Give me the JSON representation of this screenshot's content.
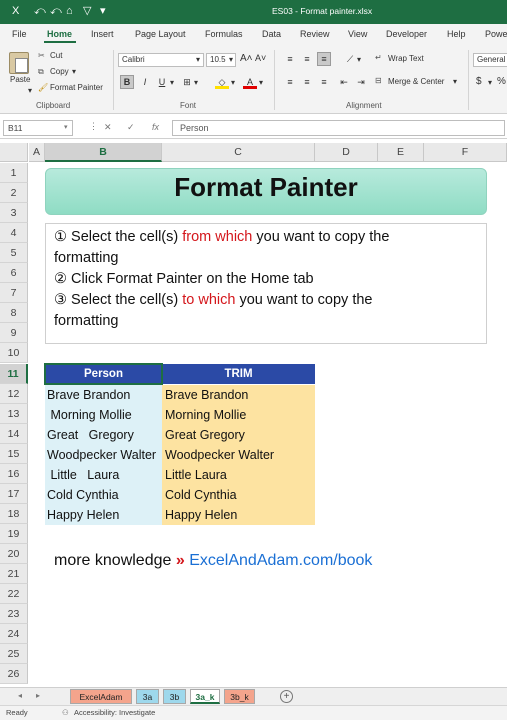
{
  "window": {
    "title": "ES03 - Format painter.xlsx",
    "quick_access": [
      "X",
      "⤺",
      "⤺",
      "⌂",
      "▽",
      "▾"
    ]
  },
  "ribbon_tabs": [
    "File",
    "Home",
    "Insert",
    "Page Layout",
    "Formulas",
    "Data",
    "Review",
    "View",
    "Developer",
    "Help",
    "Power"
  ],
  "active_tab": "Home",
  "clipboard": {
    "paste": "Paste",
    "cut": "Cut",
    "copy": "Copy",
    "format_painter": "Format Painter",
    "group_label": "Clipboard"
  },
  "font": {
    "name": "Calibri",
    "size": "10.5",
    "bold": "B",
    "italic": "I",
    "underline": "U",
    "font_color_glyph": "A",
    "group_label": "Font"
  },
  "alignment": {
    "wrap_text": "Wrap Text",
    "merge_center": "Merge & Center",
    "group_label": "Alignment"
  },
  "number": {
    "format": "General",
    "currency": "$"
  },
  "formula_bar": {
    "name_box": "B11",
    "cancel": "✕",
    "enter": "✓",
    "fx": "fx",
    "content": "Person"
  },
  "columns": [
    "A",
    "B",
    "C",
    "D",
    "E",
    "F"
  ],
  "selected_column": "B",
  "rows": [
    "1",
    "2",
    "3",
    "4",
    "5",
    "6",
    "7",
    "8",
    "9",
    "10",
    "11",
    "12",
    "13",
    "14",
    "15",
    "16",
    "17",
    "18",
    "19",
    "20",
    "21",
    "22",
    "23",
    "24",
    "25",
    "26"
  ],
  "selected_row": "11",
  "sheet": {
    "title": "Format Painter",
    "steps": [
      {
        "num": "①",
        "pre": " Select the cell(s) ",
        "hl": "from which",
        "post": " you want to copy the"
      },
      {
        "num": "",
        "pre": "formatting",
        "hl": "",
        "post": ""
      },
      {
        "num": "②",
        "pre": " Click Format Painter on the Home tab",
        "hl": "",
        "post": ""
      },
      {
        "num": "③",
        "pre": " Select the cell(s) ",
        "hl": "to which",
        "post": " you want to copy the"
      },
      {
        "num": "",
        "pre": "formatting",
        "hl": "",
        "post": ""
      }
    ],
    "table_headers": [
      "Person",
      "TRIM"
    ],
    "person": [
      "Brave Brandon",
      " Morning Mollie",
      "Great   Gregory",
      "Woodpecker Walter",
      " Little   Laura",
      "Cold Cynthia",
      "Happy Helen"
    ],
    "trim": [
      "Brave Brandon",
      "Morning Mollie",
      "Great Gregory",
      "Woodpecker Walter",
      "Little Laura",
      "Cold Cynthia",
      "Happy Helen"
    ],
    "promo_text": "more knowledge",
    "promo_arrow": "»",
    "promo_link": "ExcelAndAdam.com/book"
  },
  "sheet_tabs": [
    {
      "label": "ExcelAdam",
      "color": "#f4a48c"
    },
    {
      "label": "3a",
      "color": "#9ed8ec"
    },
    {
      "label": "3b",
      "color": "#9ed8ec"
    },
    {
      "label": "3a_k",
      "color": "#ffffff"
    },
    {
      "label": "3b_k",
      "color": "#f4a48c"
    }
  ],
  "active_sheet": "3a_k",
  "status": {
    "ready": "Ready",
    "accessibility": "Accessibility: Investigate"
  }
}
